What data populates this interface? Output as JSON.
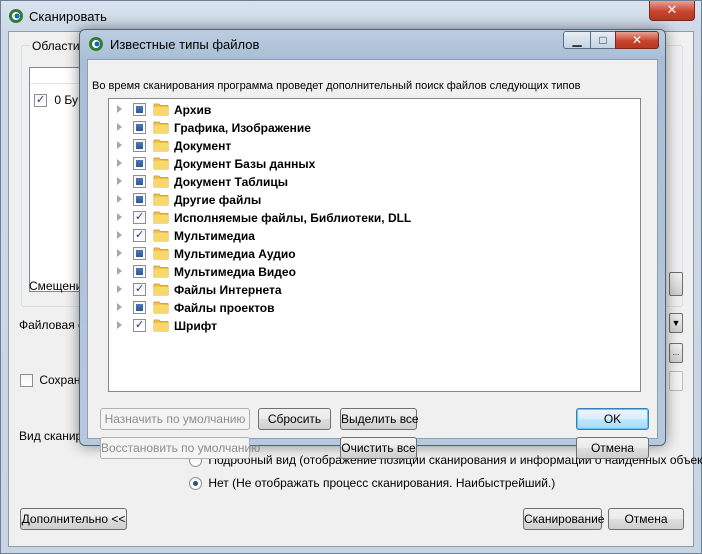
{
  "background_window": {
    "title": "Сканировать",
    "close_glyph": "✕",
    "group_label": "Области С",
    "list_row_text": "0 Бу",
    "offset_label": "Смещение",
    "filesystem_label": "Файловая с",
    "save_label": "Сохрани",
    "view_label": "Вид сканиро",
    "radio_detailed": "Подробный вид (отображение позиции сканирования и информации о найденных объектах)",
    "radio_none": "Нет (Не отображать процесс сканирования. Наибыстрейший.)",
    "advanced_button": "Дополнительно <<",
    "scan_button": "Сканирование",
    "cancel_button": "Отмена",
    "dropdown_glyph": "▼",
    "ellipsis_glyph": "..."
  },
  "dialog": {
    "title": "Известные типы файлов",
    "min_glyph": "▁",
    "max_glyph": "□",
    "close_glyph": "✕",
    "description": "Во время сканирования программа проведет дополнительный поиск файлов следующих типов",
    "file_types": [
      {
        "label": "Архив",
        "state": "partial"
      },
      {
        "label": "Графика, Изображение",
        "state": "partial"
      },
      {
        "label": "Документ",
        "state": "partial"
      },
      {
        "label": "Документ Базы данных",
        "state": "partial"
      },
      {
        "label": "Документ Таблицы",
        "state": "partial"
      },
      {
        "label": "Другие файлы",
        "state": "partial"
      },
      {
        "label": "Исполняемые файлы, Библиотеки, DLL",
        "state": "checked"
      },
      {
        "label": "Мультимедиа",
        "state": "checked"
      },
      {
        "label": "Мультимедиа Аудио",
        "state": "partial"
      },
      {
        "label": "Мультимедиа Видео",
        "state": "partial"
      },
      {
        "label": "Файлы Интернета",
        "state": "checked"
      },
      {
        "label": "Файлы проектов",
        "state": "partial"
      },
      {
        "label": "Шрифт",
        "state": "checked"
      }
    ],
    "buttons": {
      "set_default": "Назначить по умолчанию",
      "reset": "Сбросить",
      "select_all": "Выделить все",
      "ok": "OK",
      "restore_default": "Восстановить по умолчанию",
      "clear_all": "Очистить все",
      "cancel": "Отмена"
    }
  },
  "colors": {
    "title_glass": "#bccde0",
    "close_red": "#c7452f",
    "folder_yellow": "#f1c24d",
    "checkbox_fill": "#2c5a99"
  }
}
